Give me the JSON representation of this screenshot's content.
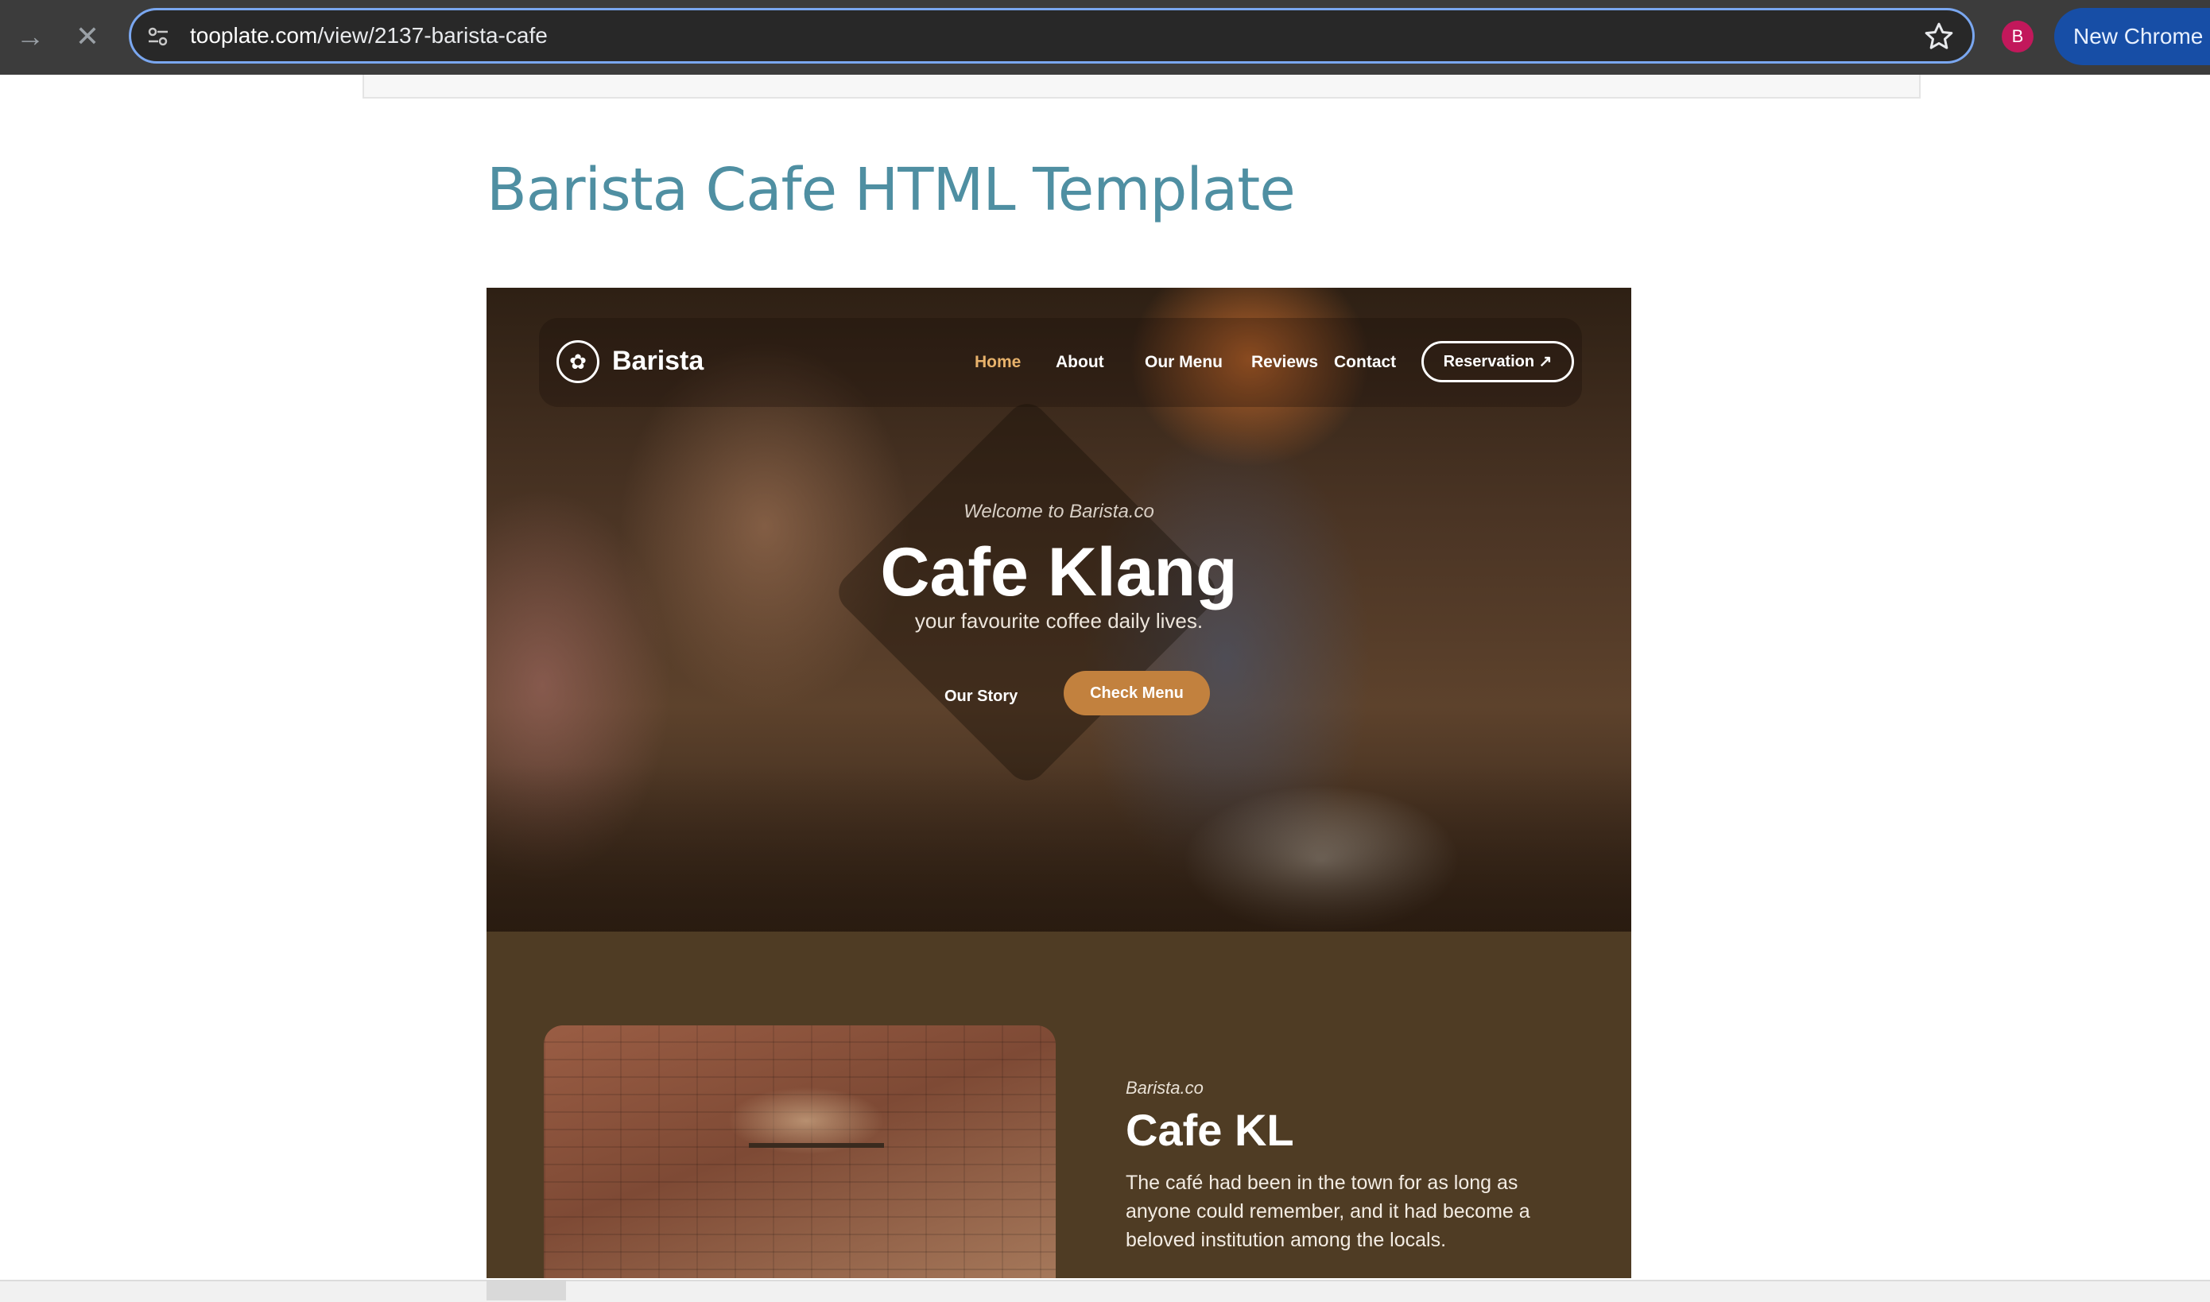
{
  "browser": {
    "url_host": "tooplate.com",
    "url_path": "/view/2137-barista-cafe",
    "avatar_letter": "B",
    "new_chrome_label": "New Chrome a"
  },
  "page": {
    "title": "Barista Cafe HTML Template"
  },
  "preview": {
    "brand": "Barista",
    "nav": [
      "Home",
      "About",
      "Our Menu",
      "Reviews",
      "Contact"
    ],
    "reservation": "Reservation ↗",
    "welcome": "Welcome to Barista.co",
    "hero_title": "Cafe Klang",
    "hero_subtitle": "your favourite coffee daily lives.",
    "our_story": "Our Story",
    "check_menu": "Check Menu",
    "about_kicker": "Barista.co",
    "about_title": "Cafe KL",
    "about_text": "The café had been in the town for as long as anyone could remember, and it had become a beloved institution among the locals."
  },
  "colors": {
    "title": "#4f8fa2",
    "accent_nav": "#e8b26b",
    "button": "#c2813e",
    "section_bg": "#4f3c24"
  }
}
